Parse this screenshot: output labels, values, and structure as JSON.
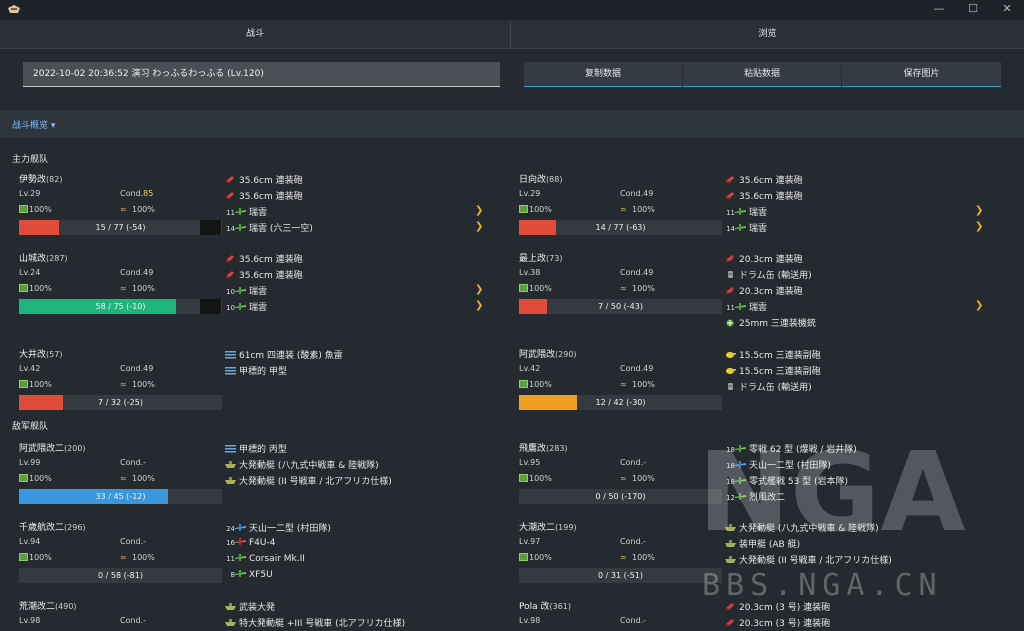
{
  "window": {
    "minimize": "—",
    "maximize": "☐",
    "close": "✕"
  },
  "tabs": [
    {
      "label": "战斗"
    },
    {
      "label": "浏览"
    }
  ],
  "battle_input": {
    "value": "2022-10-02 20:36:52 演习 わっふるわっふる (Lv.120)"
  },
  "buttons": {
    "copy": "复制数据",
    "paste": "粘贴数据",
    "save": "保存图片"
  },
  "section": {
    "title": "战斗概览 ▾"
  },
  "main_fleet": {
    "title": "主力舰队",
    "ships": [
      {
        "name": "伊勢改",
        "id": "(82)",
        "lv": "Lv.29",
        "cond_label": "Cond.",
        "cond": "85",
        "fuel": "100%",
        "ammo": "100%",
        "hp": "15 / 77 (-54)",
        "hp_ratio": 0.195,
        "hp_color": "#e04b3a",
        "equips": [
          {
            "icon": "gun-red",
            "name": "35.6cm 連装砲"
          },
          {
            "icon": "gun-red",
            "name": "35.6cm 連装砲"
          },
          {
            "icon": "plane-green",
            "n": "11",
            "name": "瑞雲"
          },
          {
            "icon": "plane-green",
            "n": "14",
            "name": "瑞雲 (六三一空)"
          }
        ]
      },
      {
        "name": "日向改",
        "id": "(88)",
        "lv": "Lv.29",
        "cond_label": "Cond.",
        "cond": "49",
        "fuel": "100%",
        "ammo": "100%",
        "hp": "14 / 77 (-63)",
        "hp_ratio": 0.182,
        "hp_color": "#e04b3a",
        "equips": [
          {
            "icon": "gun-red",
            "name": "35.6cm 連装砲"
          },
          {
            "icon": "gun-red",
            "name": "35.6cm 連装砲"
          },
          {
            "icon": "plane-green",
            "n": "11",
            "name": "瑞雲"
          },
          {
            "icon": "plane-green",
            "n": "14",
            "name": "瑞雲"
          }
        ]
      },
      {
        "name": "山城改",
        "id": "(287)",
        "lv": "Lv.24",
        "cond_label": "Cond.",
        "cond": "49",
        "fuel": "100%",
        "ammo": "100%",
        "hp": "58 / 75 (-10)",
        "hp_ratio": 0.773,
        "hp_color": "#1fb57f",
        "equips": [
          {
            "icon": "gun-red",
            "name": "35.6cm 連装砲"
          },
          {
            "icon": "gun-red",
            "name": "35.6cm 連装砲"
          },
          {
            "icon": "plane-green",
            "n": "10",
            "name": "瑞雲"
          },
          {
            "icon": "plane-green",
            "n": "10",
            "name": "瑞雲"
          }
        ]
      },
      {
        "name": "最上改",
        "id": "(73)",
        "lv": "Lv.38",
        "cond_label": "Cond.",
        "cond": "49",
        "fuel": "100%",
        "ammo": "100%",
        "hp": "7 / 50 (-43)",
        "hp_ratio": 0.14,
        "hp_color": "#e04b3a",
        "equips": [
          {
            "icon": "gun-red",
            "name": "20.3cm 連装砲"
          },
          {
            "icon": "drum",
            "name": "ドラム缶 (輸送用)"
          },
          {
            "icon": "gun-red",
            "name": "20.3cm 連装砲"
          },
          {
            "icon": "plane-green",
            "n": "11",
            "name": "瑞雲"
          },
          {
            "icon": "aa-green",
            "n": "",
            "name": "25mm 三連装機銃"
          }
        ]
      },
      {
        "name": "大井改",
        "id": "(57)",
        "lv": "Lv.42",
        "cond_label": "Cond.",
        "cond": "49",
        "fuel": "100%",
        "ammo": "100%",
        "hp": "7 / 32 (-25)",
        "hp_ratio": 0.219,
        "hp_color": "#e04b3a",
        "equips": [
          {
            "icon": "torp",
            "name": "61cm 四連装 (酸素) 魚雷"
          },
          {
            "icon": "torp",
            "name": "甲標的 甲型"
          }
        ]
      },
      {
        "name": "阿武隈改",
        "id": "(290)",
        "lv": "Lv.42",
        "cond_label": "Cond.",
        "cond": "49",
        "fuel": "100%",
        "ammo": "100%",
        "hp": "12 / 42 (-30)",
        "hp_ratio": 0.286,
        "hp_color": "#f0a020",
        "equips": [
          {
            "icon": "gun-yellow",
            "name": "15.5cm 三連装副砲"
          },
          {
            "icon": "gun-yellow",
            "name": "15.5cm 三連装副砲"
          },
          {
            "icon": "drum",
            "name": "ドラム缶 (輸送用)"
          }
        ]
      }
    ]
  },
  "enemy_fleet": {
    "title": "敌军舰队",
    "ships": [
      {
        "name": "阿武隈改二",
        "id": "(200)",
        "lv": "Lv.99",
        "cond_label": "Cond.",
        "cond": "-",
        "fuel": "100%",
        "ammo": "100%",
        "hp": "33 / 45 (-12)",
        "hp_ratio": 0.733,
        "hp_color": "#3a97de",
        "equips": [
          {
            "icon": "torp",
            "name": "甲標的 丙型"
          },
          {
            "icon": "landing",
            "name": "大発動艇 (八九式中戦車 & 陸戦隊)"
          },
          {
            "icon": "landing",
            "name": "大発動艇 (II 号戦車 / 北アフリカ仕様)"
          }
        ]
      },
      {
        "name": "飛鷹改",
        "id": "(283)",
        "lv": "Lv.95",
        "cond_label": "Cond.",
        "cond": "-",
        "fuel": "100%",
        "ammo": "100%",
        "hp": "0 / 50 (-170)",
        "hp_ratio": 0,
        "hp_color": "#e04b3a",
        "equips": [
          {
            "icon": "plane-green",
            "n": "18",
            "name": "零戦 62 型 (爆戦 / 岩井隊)"
          },
          {
            "icon": "plane-blue",
            "n": "18",
            "name": "天山一二型 (村田隊)"
          },
          {
            "icon": "plane-green",
            "n": "18",
            "name": "零式艦戦 53 型 (岩本隊)"
          },
          {
            "icon": "plane-green",
            "n": "12",
            "name": "烈風改二"
          }
        ]
      },
      {
        "name": "千歳航改二",
        "id": "(296)",
        "lv": "Lv.94",
        "cond_label": "Cond.",
        "cond": "-",
        "fuel": "100%",
        "ammo": "100%",
        "hp": "0 / 58 (-81)",
        "hp_ratio": 0,
        "hp_color": "#e04b3a",
        "equips": [
          {
            "icon": "plane-blue",
            "n": "24",
            "name": "天山一二型 (村田隊)"
          },
          {
            "icon": "plane-red",
            "n": "16",
            "name": "F4U-4"
          },
          {
            "icon": "plane-green",
            "n": "11",
            "name": "Corsair Mk.II"
          },
          {
            "icon": "plane-green",
            "n": "8",
            "name": "XF5U"
          }
        ]
      },
      {
        "name": "大潮改二",
        "id": "(199)",
        "lv": "Lv.97",
        "cond_label": "Cond.",
        "cond": "-",
        "fuel": "100%",
        "ammo": "100%",
        "hp": "0 / 31 (-51)",
        "hp_ratio": 0,
        "hp_color": "#e04b3a",
        "equips": [
          {
            "icon": "landing",
            "name": "大発動艇 (八九式中戦車 & 陸戦隊)"
          },
          {
            "icon": "landing",
            "name": "装甲艇 (AB 艇)"
          },
          {
            "icon": "landing",
            "name": "大発動艇 (II 号戦車 / 北アフリカ仕様)"
          }
        ]
      },
      {
        "name": "荒潮改二",
        "id": "(490)",
        "lv": "Lv.98",
        "cond_label": "Cond.",
        "cond": "-",
        "fuel": "",
        "ammo": "",
        "hp": "",
        "hp_ratio": 0,
        "hp_color": "#e04b3a",
        "equips": [
          {
            "icon": "landing",
            "name": "武装大発"
          },
          {
            "icon": "landing",
            "name": "特大発動艇 +III 号戦車 (北アフリカ仕様)"
          }
        ]
      },
      {
        "name": "Pola 改",
        "id": "(361)",
        "lv": "Lv.98",
        "cond_label": "Cond.",
        "cond": "-",
        "fuel": "",
        "ammo": "",
        "hp": "",
        "hp_ratio": 0,
        "hp_color": "#e04b3a",
        "equips": [
          {
            "icon": "gun-red",
            "name": "20.3cm (3 号) 連装砲"
          },
          {
            "icon": "gun-red",
            "name": "20.3cm (3 号) 連装砲"
          }
        ]
      }
    ]
  },
  "watermark": {
    "logo": "NGA",
    "url": "BBS.NGA.CN"
  }
}
